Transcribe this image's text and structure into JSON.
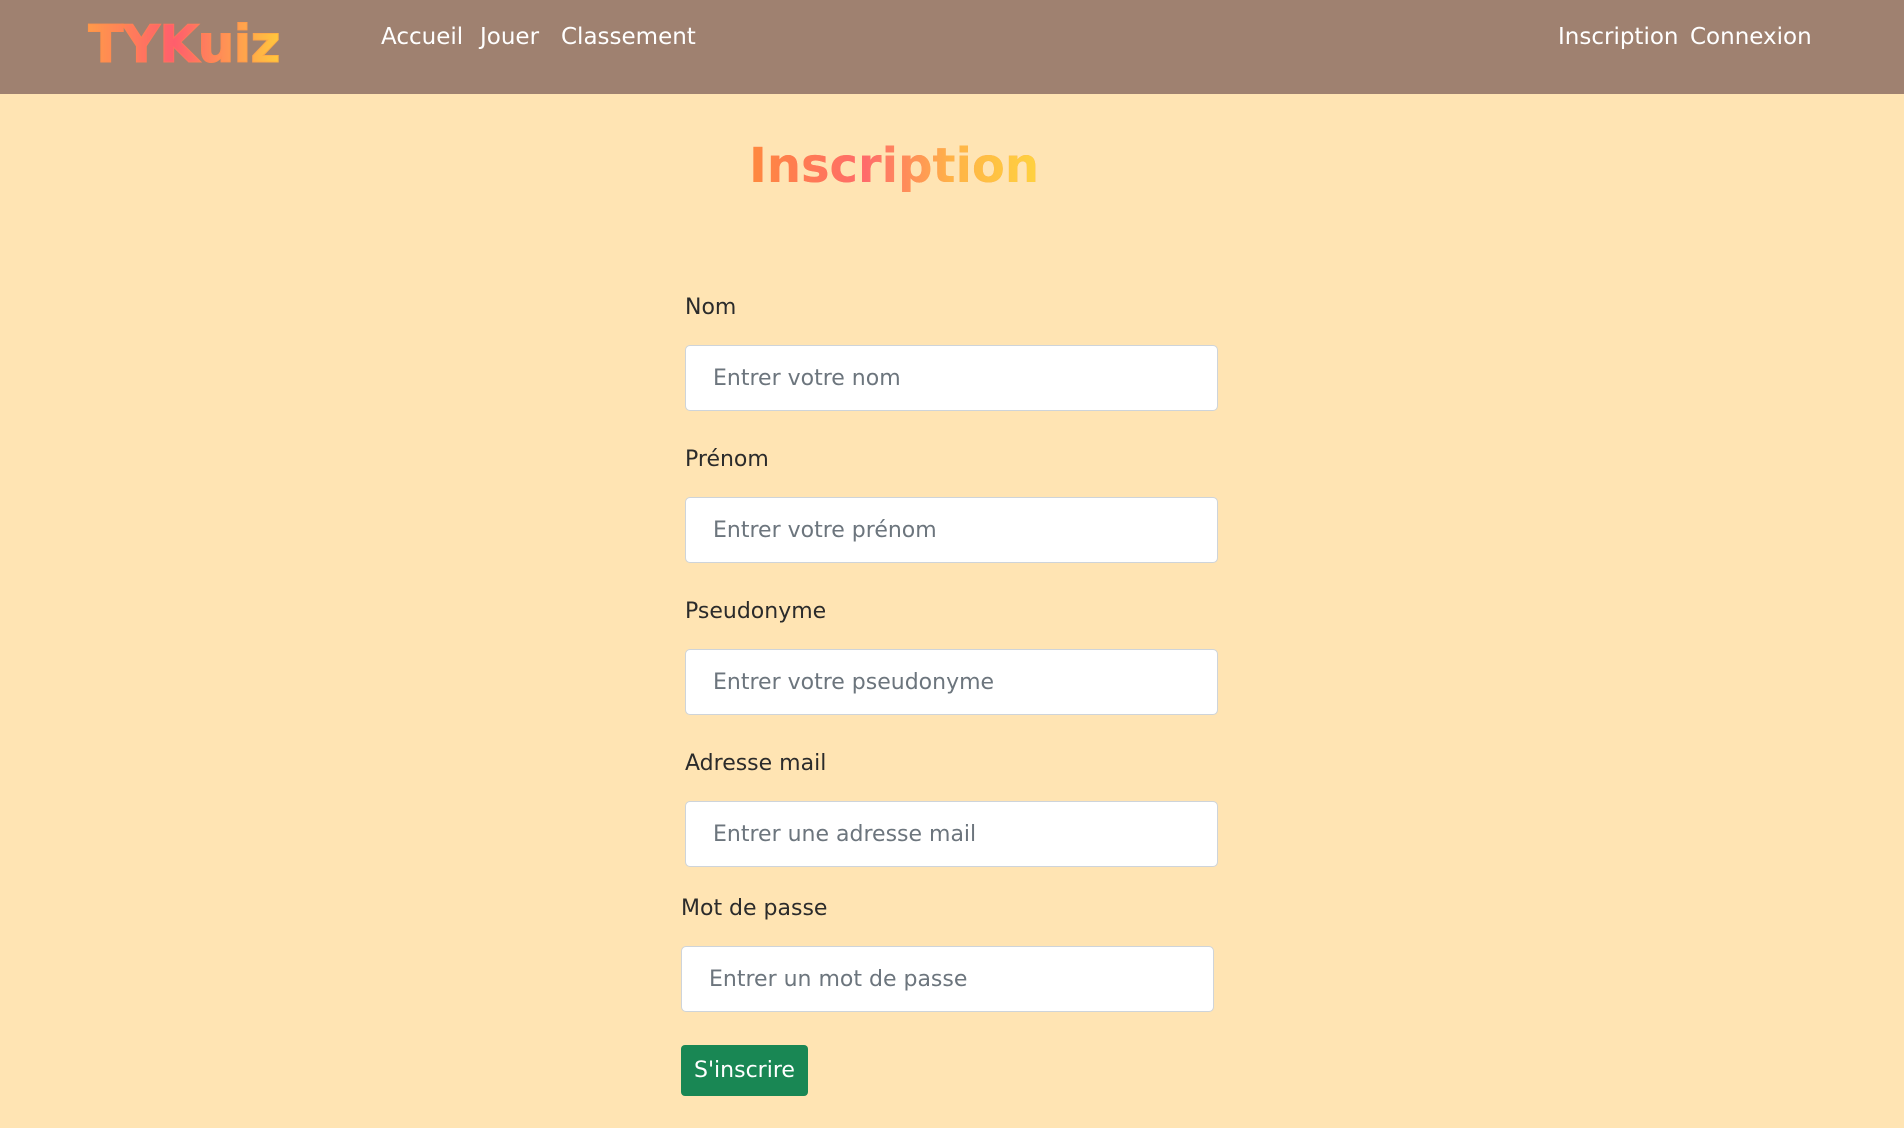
{
  "navbar": {
    "logo": "TYKuiz",
    "links_left": [
      "Accueil",
      "Jouer",
      "Classement"
    ],
    "links_right": [
      "Inscription",
      "Connexion"
    ]
  },
  "page": {
    "title": "Inscription"
  },
  "form": {
    "fields": [
      {
        "label": "Nom",
        "placeholder": "Entrer votre nom",
        "value": ""
      },
      {
        "label": "Prénom",
        "placeholder": "Entrer votre prénom",
        "value": ""
      },
      {
        "label": "Pseudonyme",
        "placeholder": "Entrer votre pseudonyme",
        "value": ""
      },
      {
        "label": "Adresse mail",
        "placeholder": "Entrer une adresse mail",
        "value": ""
      },
      {
        "label": "Mot de passe",
        "placeholder": "Entrer un mot de passe",
        "value": ""
      }
    ],
    "submit_label": "S'inscrire"
  },
  "colors": {
    "navbar_bg": "#9F8170",
    "page_bg": "#FFE4B3",
    "submit_bg": "#198754",
    "logo_gradient": [
      "#FF9A4A",
      "#FF5E6C",
      "#FFC93C"
    ]
  }
}
